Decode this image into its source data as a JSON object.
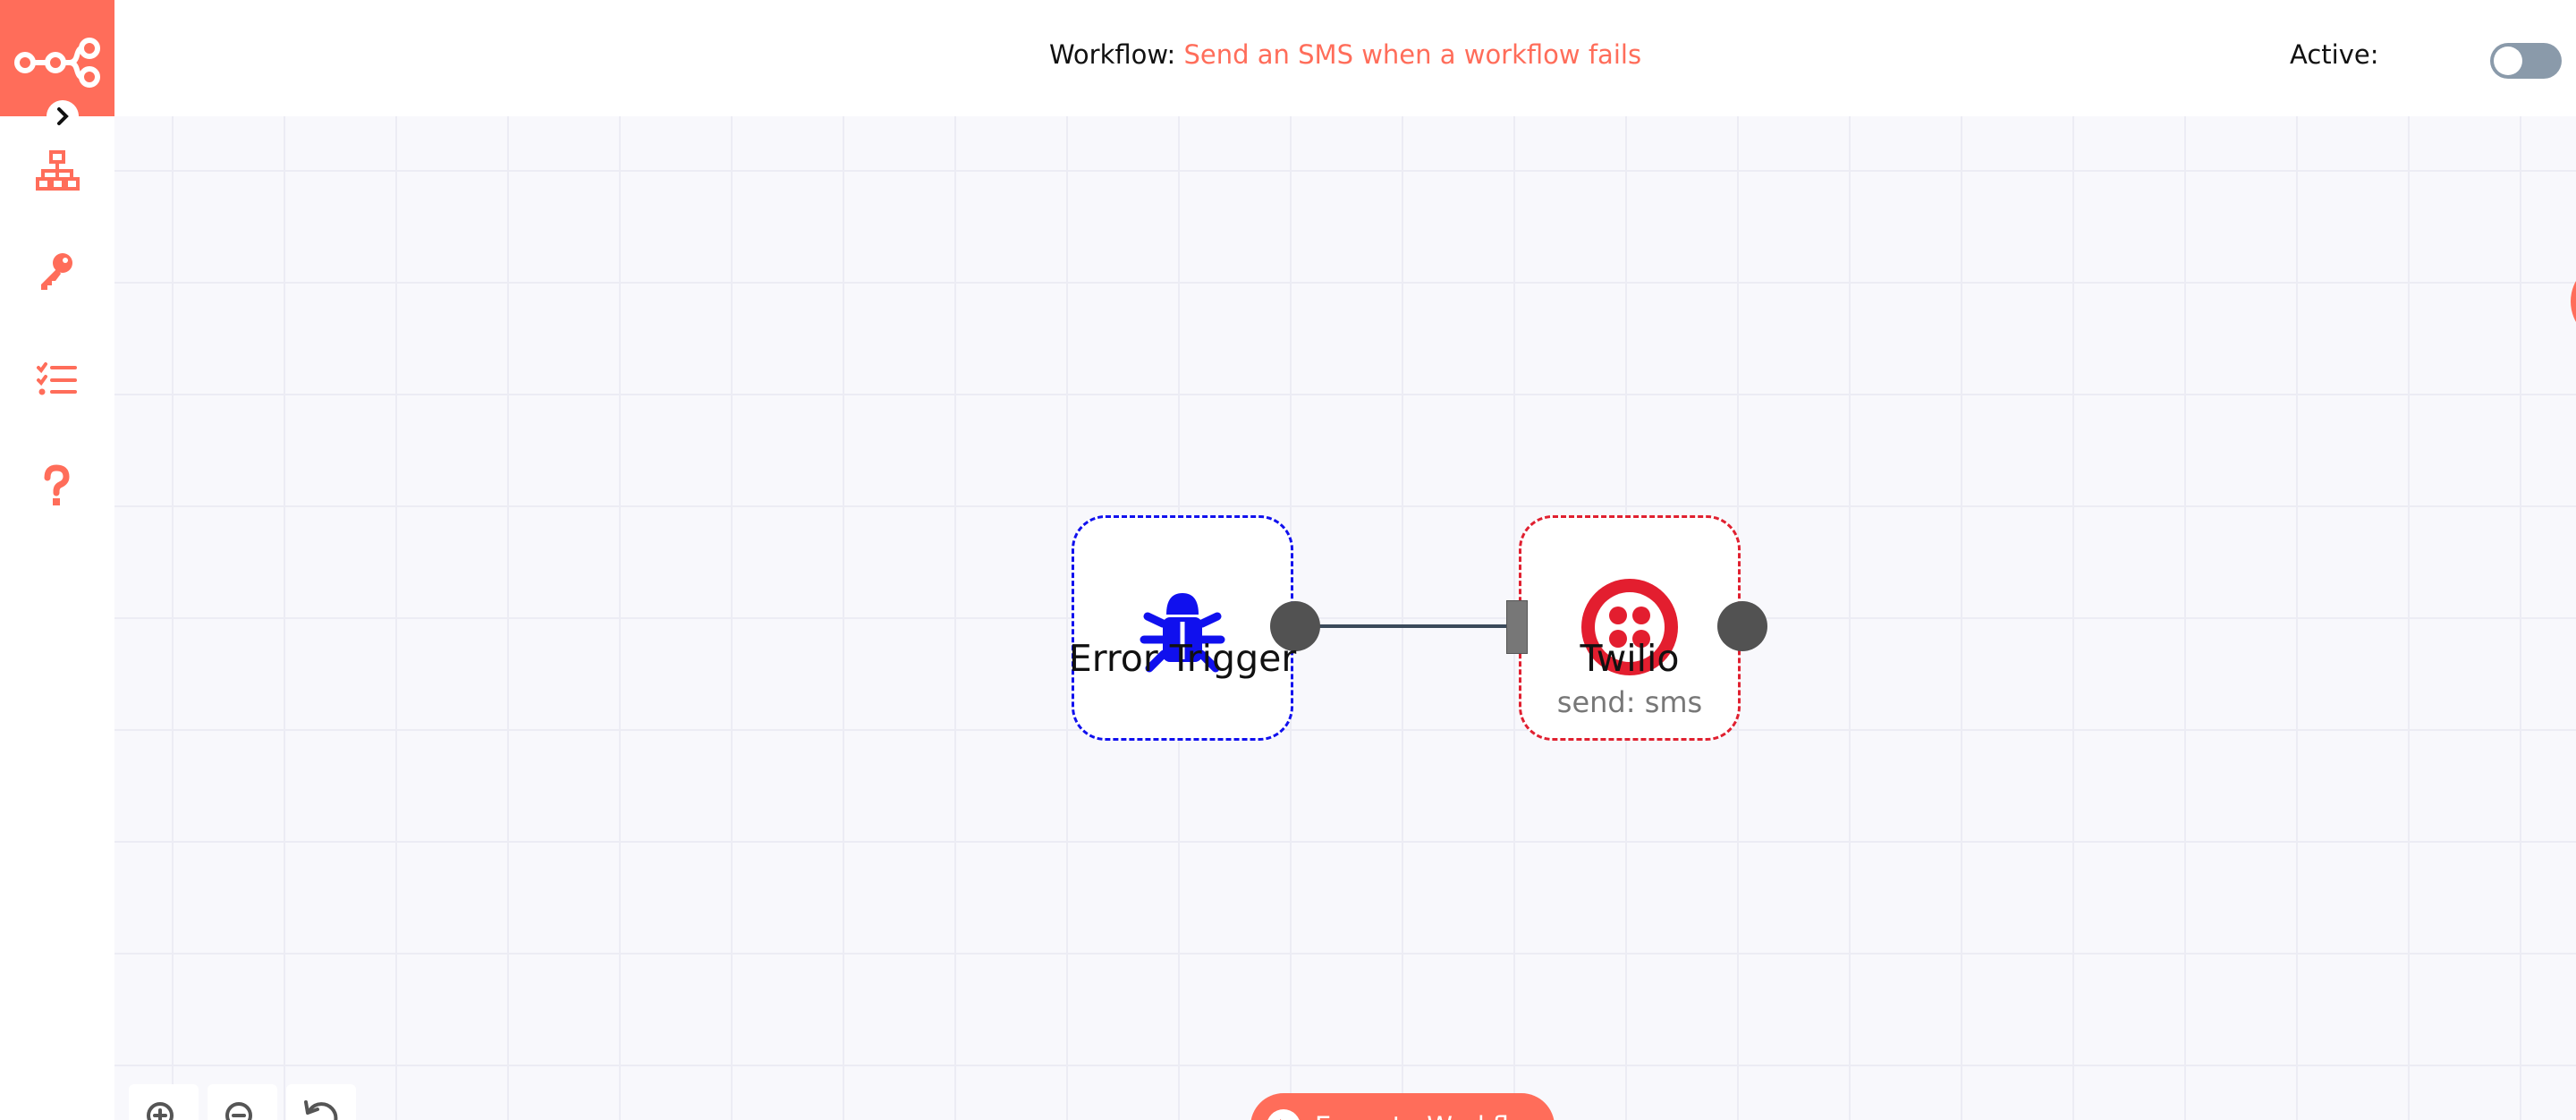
{
  "header": {
    "workflow_label": "Workflow:",
    "workflow_name": "Send an SMS when a workflow fails",
    "active_label": "Active:",
    "active_on": false
  },
  "sidebar": {
    "items": [
      {
        "icon": "network-icon"
      },
      {
        "icon": "key-icon"
      },
      {
        "icon": "tasks-icon"
      },
      {
        "icon": "question-icon"
      }
    ]
  },
  "nodes": [
    {
      "title": "Error Trigger",
      "subtitle": "",
      "icon": "bug-icon"
    },
    {
      "title": "Twilio",
      "subtitle": "send: sms",
      "icon": "twilio-icon"
    }
  ],
  "toolbar": {
    "execute_label": "Execute Workflow"
  },
  "colors": {
    "accent": "#ff6d5a",
    "error_border": "#1010ee",
    "twilio_border": "#e02030",
    "twilio_brand": "#e31e2f",
    "bug_icon": "#1010ee"
  }
}
